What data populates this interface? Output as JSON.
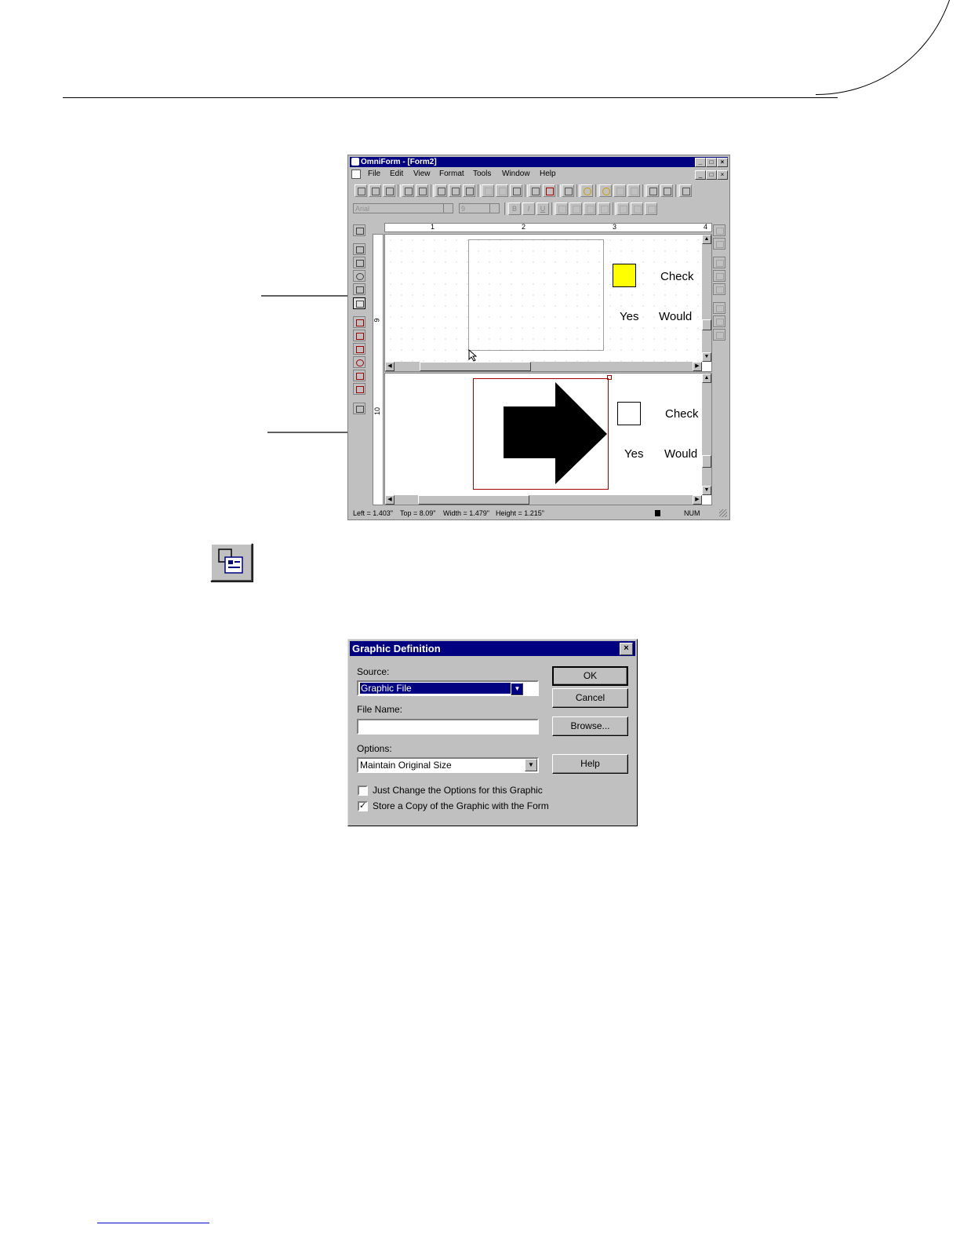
{
  "app": {
    "title": "OmniForm - [Form2]",
    "window_buttons": {
      "minimize": "_",
      "maximize": "□",
      "close": "×"
    },
    "menu": [
      {
        "id": "file",
        "label": "File"
      },
      {
        "id": "edit",
        "label": "Edit"
      },
      {
        "id": "view",
        "label": "View"
      },
      {
        "id": "format",
        "label": "Format"
      },
      {
        "id": "tools",
        "label": "Tools"
      },
      {
        "id": "window",
        "label": "Window"
      },
      {
        "id": "help",
        "label": "Help"
      }
    ],
    "font_box": {
      "value": "Arial"
    },
    "size_box": {
      "value": "9"
    },
    "format_buttons": {
      "bold": "B",
      "italic": "I",
      "underline": "U"
    },
    "ruler": {
      "h": [
        "1",
        "2",
        "3",
        "4"
      ],
      "v": [
        "9",
        "10"
      ]
    },
    "form_top": {
      "label1": "Check",
      "label2": "Yes",
      "label3": "Would",
      "checkbox_color": "#ffff00"
    },
    "form_bottom": {
      "label1": "Check",
      "label2": "Yes",
      "label3": "Would"
    },
    "status": {
      "left": "Left = 1.403\"",
      "top": "Top = 8.09\"",
      "width": "Width = 1.479\"",
      "height": "Height = 1.215\"",
      "num": "NUM"
    }
  },
  "tool_icon": {
    "name": "graphic-tool-icon"
  },
  "dialog": {
    "title": "Graphic Definition",
    "source_label": "Source:",
    "source_value": "Graphic File",
    "filename_label": "File Name:",
    "filename_value": "",
    "options_label": "Options:",
    "options_value": "Maintain Original Size",
    "check1_label": "Just Change the Options for this Graphic",
    "check1_checked": false,
    "check2_label": "Store a Copy of the Graphic with the Form",
    "check2_checked": true,
    "check_mark": "✓",
    "ok": "OK",
    "cancel": "Cancel",
    "browse": "Browse...",
    "help": "Help",
    "close": "×"
  }
}
